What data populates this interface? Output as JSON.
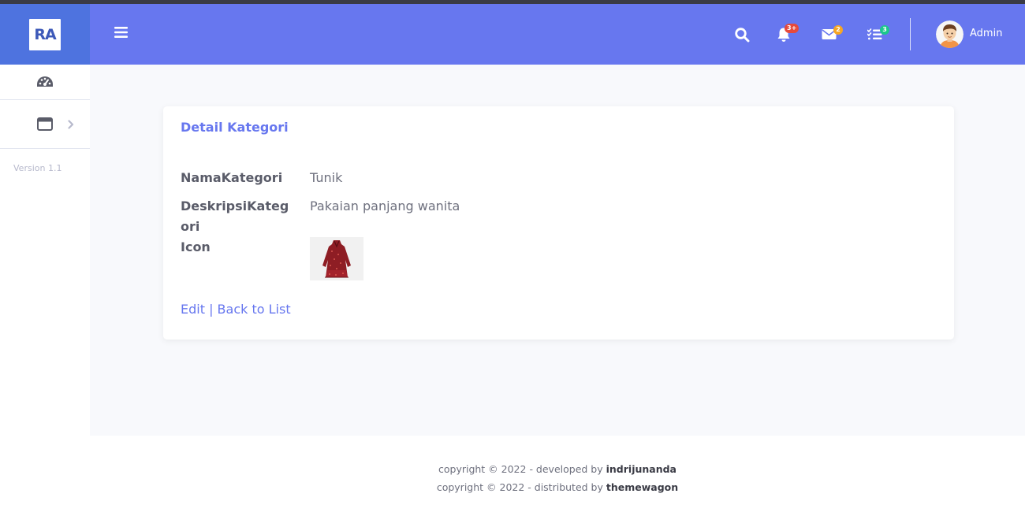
{
  "brand": {
    "logo_text": "RA"
  },
  "sidebar": {
    "items": [
      {
        "icon": "tachometer-icon"
      },
      {
        "icon": "window-icon",
        "has_chevron": true
      }
    ],
    "version": "Version 1.1"
  },
  "topbar": {
    "alerts_badge": "3+",
    "messages_badge": "2",
    "tasks_badge": "3",
    "user_name": "Admin",
    "colors": {
      "bar": "#6777ef",
      "alerts": "#e74a3b",
      "messages": "#f6a623",
      "tasks": "#1cc88a"
    }
  },
  "card": {
    "title": "Detail Kategori",
    "fields": [
      {
        "label": "NamaKategori",
        "value": "Tunik"
      },
      {
        "label": "DeskripsiKategori",
        "value": "Pakaian panjang wanita"
      },
      {
        "label": "Icon",
        "value": ""
      }
    ],
    "edit_link": "Edit",
    "separator": " | ",
    "back_link": "Back to List"
  },
  "footer": {
    "line1_prefix": "copyright © 2022 - developed by ",
    "line1_name": "indrijunanda",
    "line2_prefix": "copyright © 2022 - distributed by ",
    "line2_name": "themewagon"
  }
}
